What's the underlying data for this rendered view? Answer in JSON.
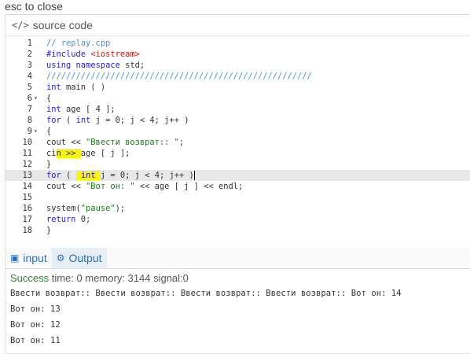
{
  "esc_label": "esc to close",
  "panel_title": "source code",
  "code_lines": [
    {
      "n": "1",
      "fold": "",
      "html": "<span class=\"cm\">// replay.cpp</span>"
    },
    {
      "n": "2",
      "fold": "",
      "html": "<span class=\"pp\">#include</span> <span class=\"inc\">&lt;iostream&gt;</span>"
    },
    {
      "n": "3",
      "fold": "",
      "html": "<span class=\"kw\">using</span> <span class=\"kw\">namespace</span> std;"
    },
    {
      "n": "4",
      "fold": "",
      "html": "<span class=\"cm\">//////////////////////////////////////////////////////</span>"
    },
    {
      "n": "5",
      "fold": "",
      "html": "<span class=\"kw\">int</span> main ( )"
    },
    {
      "n": "6",
      "fold": "▾",
      "html": "{"
    },
    {
      "n": "7",
      "fold": "",
      "html": "<span class=\"kw\">int</span> age [ 4 ];"
    },
    {
      "n": "8",
      "fold": "",
      "html": "<span class=\"kw\">for</span> ( <span class=\"kw\">int</span> j = 0; j &lt; 4; j++ )"
    },
    {
      "n": "9",
      "fold": "▾",
      "html": "{"
    },
    {
      "n": "10",
      "fold": "",
      "html": "cout &lt;&lt; <span class=\"str\">\"Ввести возврат:: \"</span>;"
    },
    {
      "n": "11",
      "fold": "",
      "html": "ci<span class=\"hl\">n &gt;&gt; </span>age [ j ];"
    },
    {
      "n": "12",
      "fold": "",
      "html": "}"
    },
    {
      "n": "13",
      "fold": "",
      "html": "<span class=\"kw\">for</span> ( <span class=\"hl\"> <span class=\"kw\">int</span> </span>j = 0; j &lt; 4; j++ )<span class=\"caret\"></span>",
      "active": true
    },
    {
      "n": "14",
      "fold": "",
      "html": "cout &lt;&lt; <span class=\"str\">\"Вот он: \"</span> &lt;&lt; age [ j ] &lt;&lt; endl;"
    },
    {
      "n": "15",
      "fold": "",
      "html": ""
    },
    {
      "n": "16",
      "fold": "",
      "html": "system(<span class=\"str\">\"pause\"</span>);"
    },
    {
      "n": "17",
      "fold": "",
      "html": "<span class=\"kw\">return</span> 0;"
    },
    {
      "n": "18",
      "fold": "",
      "html": "}"
    }
  ],
  "tabs": {
    "input_label": "input",
    "output_label": "Output"
  },
  "result": {
    "status": "Success",
    "details": " time: 0 memory: 3144 signal:0"
  },
  "output_lines": [
    "Ввести возврат:: Ввести возврат:: Ввести возврат:: Ввести возврат:: Вот он: 14",
    "Вот он: 13",
    "Вот он: 12",
    "Вот он: 11"
  ]
}
